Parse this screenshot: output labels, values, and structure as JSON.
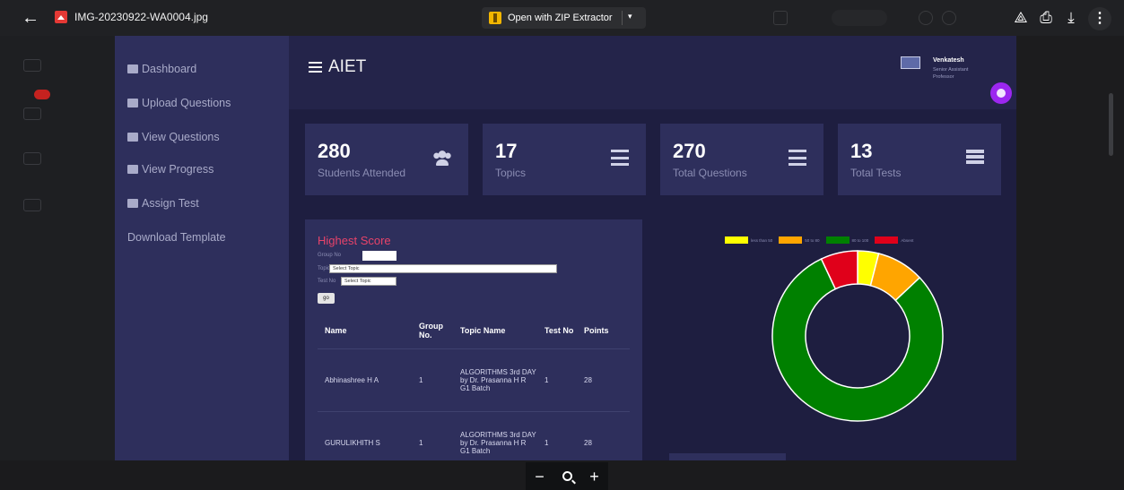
{
  "viewer": {
    "back_glyph": "←",
    "filename": "IMG-20230922-WA0004.jpg",
    "open_with_label": "Open with ZIP Extractor",
    "caret_glyph": "▾",
    "icons": [
      "add-to-drive-icon",
      "print-icon",
      "download-icon",
      "more-vert-icon"
    ],
    "icon_glyphs": {
      "drive": "⟁",
      "print": "⎙",
      "download": "⤓",
      "more": "⋮"
    },
    "zoom": {
      "minus": "−",
      "plus": "+"
    }
  },
  "app": {
    "brand": "AIET",
    "user_name": "Venkatesh",
    "user_role": "Senior Assistant Professor",
    "sidebar": [
      {
        "label": "Dashboard",
        "icon": "dashboard-icon"
      },
      {
        "label": "Upload Questions",
        "icon": "table-icon"
      },
      {
        "label": "View Questions",
        "icon": "table-icon"
      },
      {
        "label": "View Progress",
        "icon": "table-icon"
      },
      {
        "label": "Assign Test",
        "icon": "table-icon"
      },
      {
        "label": "Download Template",
        "icon": ""
      }
    ],
    "stats": [
      {
        "value": "280",
        "label": "Students Attended",
        "icon": "users-icon"
      },
      {
        "value": "17",
        "label": "Topics",
        "icon": "list-icon"
      },
      {
        "value": "270",
        "label": "Total Questions",
        "icon": "list-icon"
      },
      {
        "value": "13",
        "label": "Total Tests",
        "icon": "server-icon"
      }
    ],
    "highest_score": {
      "title": "Highest Score",
      "group_no_label": "Group No",
      "topic_label": "Topic",
      "topic_placeholder": "Select Topic",
      "test_no_label": "Test No",
      "test_placeholder": "Select Topic",
      "button_label": "go",
      "columns": [
        "Name",
        "Group No.",
        "Topic Name",
        "Test No",
        "Points"
      ],
      "rows": [
        {
          "name": "Abhinashree H A",
          "group": "1",
          "topic": "ALGORITHMS 3rd DAY by Dr. Prasanna H R G1 Batch",
          "test": "1",
          "points": "28"
        },
        {
          "name": "GURULIKHITH S",
          "group": "1",
          "topic": "ALGORITHMS 3rd DAY by Dr. Prasanna H R G1 Batch",
          "test": "1",
          "points": "28"
        }
      ]
    }
  },
  "chart_data": {
    "type": "pie",
    "variant": "doughnut",
    "legend_position": "top",
    "series": [
      {
        "name": "less than 50",
        "value": 4,
        "color": "#ffff00"
      },
      {
        "name": "50 to 80",
        "value": 9,
        "color": "#ffa500"
      },
      {
        "name": "80 to 100",
        "value": 80,
        "color": "#008000"
      },
      {
        "name": "Absent",
        "value": 7,
        "color": "#e0001a"
      }
    ]
  }
}
